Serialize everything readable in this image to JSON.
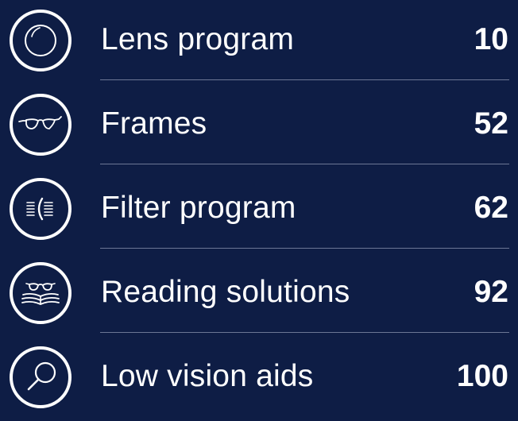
{
  "colors": {
    "background": "#0e1d45",
    "text": "#ffffff",
    "divider": "#6c7795"
  },
  "items": [
    {
      "label": "Lens program",
      "page": "10",
      "icon": "lens-icon"
    },
    {
      "label": "Frames",
      "page": "52",
      "icon": "glasses-icon"
    },
    {
      "label": "Filter program",
      "page": "62",
      "icon": "filter-icon"
    },
    {
      "label": "Reading solutions",
      "page": "92",
      "icon": "reading-icon"
    },
    {
      "label": "Low vision aids",
      "page": "100",
      "icon": "magnifier-icon"
    }
  ]
}
